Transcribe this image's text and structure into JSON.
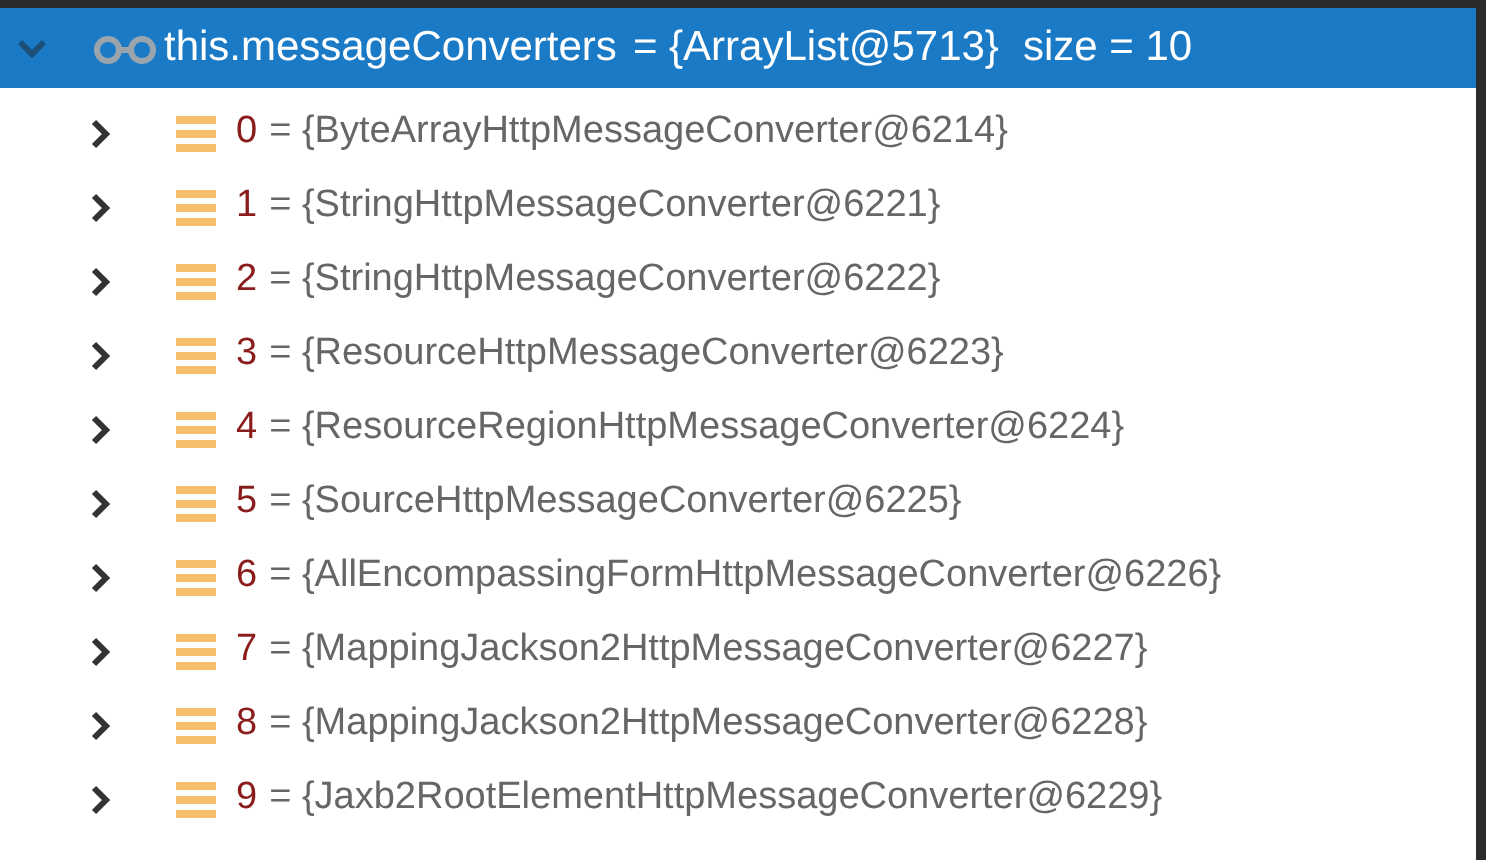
{
  "tree": {
    "name": "this.messageConverters",
    "value": "= {ArrayList@5713}",
    "size": "size = 10",
    "expanded": true,
    "selected": true,
    "children": [
      {
        "index": "0",
        "value": "= {ByteArrayHttpMessageConverter@6214}",
        "expanded": false
      },
      {
        "index": "1",
        "value": "= {StringHttpMessageConverter@6221}",
        "expanded": false
      },
      {
        "index": "2",
        "value": "= {StringHttpMessageConverter@6222}",
        "expanded": false
      },
      {
        "index": "3",
        "value": "= {ResourceHttpMessageConverter@6223}",
        "expanded": false
      },
      {
        "index": "4",
        "value": "= {ResourceRegionHttpMessageConverter@6224}",
        "expanded": false
      },
      {
        "index": "5",
        "value": "= {SourceHttpMessageConverter@6225}",
        "expanded": false
      },
      {
        "index": "6",
        "value": "= {AllEncompassingFormHttpMessageConverter@6226}",
        "expanded": false
      },
      {
        "index": "7",
        "value": "= {MappingJackson2HttpMessageConverter@6227}",
        "expanded": false
      },
      {
        "index": "8",
        "value": "= {MappingJackson2HttpMessageConverter@6228}",
        "expanded": false
      },
      {
        "index": "9",
        "value": "= {Jaxb2RootElementHttpMessageConverter@6229}",
        "expanded": false
      }
    ]
  }
}
